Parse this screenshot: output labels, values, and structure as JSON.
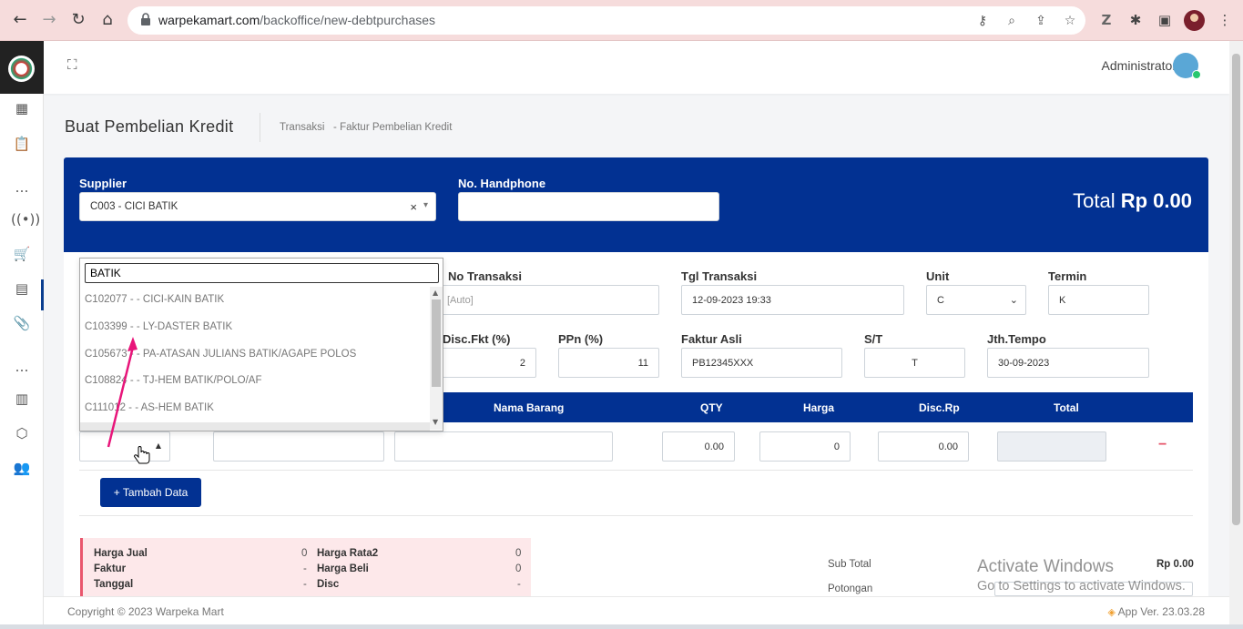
{
  "browser": {
    "url_domain": "warpekamart.com",
    "url_path": "/backoffice/new-debtpurchases"
  },
  "header": {
    "user_name": "Administrator"
  },
  "page": {
    "title": "Buat Pembelian Kredit",
    "breadcrumb_1": "Transaksi",
    "breadcrumb_sep": "-",
    "breadcrumb_2": "Faktur Pembelian Kredit"
  },
  "supplier": {
    "label": "Supplier",
    "value": "C003 - CICI BATIK",
    "clear": "×",
    "caret": "▾"
  },
  "phone": {
    "label": "No. Handphone",
    "value": ""
  },
  "total": {
    "label": "Total",
    "value": "Rp 0.00"
  },
  "fields": {
    "no_transaksi_label": "No Transaksi",
    "no_transaksi_placeholder": "[Auto]",
    "tgl_transaksi_label": "Tgl Transaksi",
    "tgl_transaksi_value": "12-09-2023 19:33",
    "unit_label": "Unit",
    "unit_value": "C",
    "termin_label": "Termin",
    "termin_value": "K",
    "disc_fkt_label": "Disc.Fkt (%)",
    "disc_fkt_value": "2",
    "ppn_label": "PPn (%)",
    "ppn_value": "11",
    "faktur_asli_label": "Faktur Asli",
    "faktur_asli_value": "PB12345XXX",
    "st_label": "S/T",
    "st_value": "T",
    "jth_tempo_label": "Jth.Tempo",
    "jth_tempo_value": "30-09-2023"
  },
  "table": {
    "headers": [
      "Nama Barang",
      "QTY",
      "Harga",
      "Disc.Rp",
      "Total"
    ],
    "row": {
      "qty": "0.00",
      "harga": "0",
      "disc": "0.00",
      "remove": "−"
    }
  },
  "add_button": "+ Tambah Data",
  "dropdown": {
    "search": "BATIK",
    "items": [
      "C102077 - - CICI-KAIN BATIK",
      "C103399 - - LY-DASTER BATIK",
      "C105673 - - PA-ATASAN JULIANS BATIK/AGAPE POLOS",
      "C108824 - - TJ-HEM BATIK/POLO/AF",
      "C111012 - - AS-HEM BATIK"
    ]
  },
  "info": {
    "harga_jual_label": "Harga Jual",
    "harga_jual_value": "0",
    "faktur_label": "Faktur",
    "faktur_value": "-",
    "tanggal_label": "Tanggal",
    "tanggal_value": "-",
    "harga_rata2_label": "Harga Rata2",
    "harga_rata2_value": "0",
    "harga_beli_label": "Harga Beli",
    "harga_beli_value": "0",
    "disc_label": "Disc",
    "disc_value": "-"
  },
  "summary": {
    "sub_total_label": "Sub Total",
    "sub_total_value": "Rp 0.00",
    "potongan_label": "Potongan"
  },
  "watermark": {
    "line1": "Activate Windows",
    "line2": "Go to Settings to activate Windows."
  },
  "footer": {
    "copyright": "Copyright © 2023 Warpeka Mart",
    "version": "App Ver. 23.03.28"
  },
  "colors": {
    "primary": "#023192",
    "danger": "#e9566d",
    "annotation_arrow": "#e8157a"
  }
}
